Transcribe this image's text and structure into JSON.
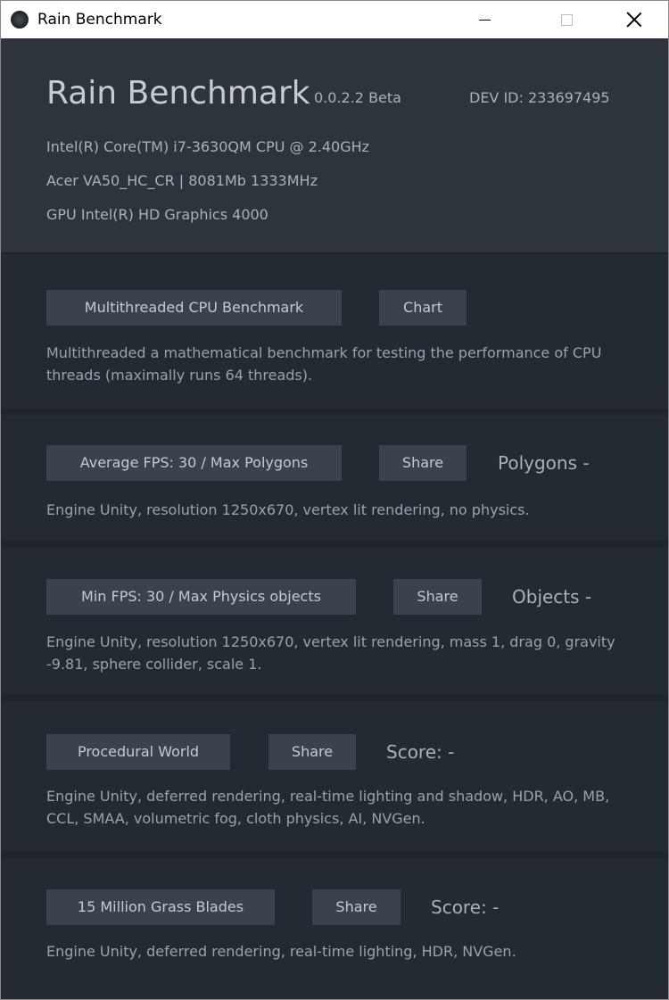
{
  "window": {
    "title": "Rain Benchmark"
  },
  "header": {
    "app_name": "Rain Benchmark",
    "version": "0.0.2.2 Beta",
    "dev_id": "DEV ID: 233697495",
    "cpu": "Intel(R) Core(TM) i7-3630QM CPU @ 2.40GHz",
    "board": "Acer VA50_HC_CR  |  8081Mb 1333MHz",
    "gpu": "GPU Intel(R) HD Graphics 4000"
  },
  "sections": [
    {
      "button_label": "Multithreaded CPU Benchmark",
      "secondary_label": "Chart",
      "result": "",
      "description": "Multithreaded a mathematical benchmark for testing the performance of CPU threads (maximally runs 64 threads)."
    },
    {
      "button_label": "Average FPS: 30 / Max Polygons",
      "secondary_label": "Share",
      "result": "Polygons -",
      "description": "Engine Unity, resolution 1250x670, vertex lit rendering, no physics."
    },
    {
      "button_label": "Min FPS: 30 / Max Physics objects",
      "secondary_label": "Share",
      "result": "Objects -",
      "description": "Engine Unity, resolution 1250x670, vertex lit rendering, mass 1, drag 0, gravity -9.81, sphere collider, scale 1."
    },
    {
      "button_label": "Procedural World",
      "secondary_label": "Share",
      "result": "Score: -",
      "description": "Engine Unity, deferred rendering, real-time lighting and shadow, HDR, AO, MB, CCL, SMAA, volumetric fog, cloth physics, AI, NVGen."
    },
    {
      "button_label": "15 Million Grass Blades",
      "secondary_label": "Share",
      "result": "Score: -",
      "description": "Engine Unity, deferred rendering, real-time lighting, HDR, NVGen."
    }
  ],
  "colors": {
    "window_bg": "#1f2429",
    "header_bg": "#2d343c",
    "section_bg": "#232a31",
    "button_bg": "#3a424c",
    "text_primary": "#c6ccd3",
    "text_secondary": "#aab1b8"
  },
  "icons": {
    "app": "rain-app-icon",
    "minimize": "minimize-icon",
    "maximize": "maximize-icon",
    "close": "close-icon"
  }
}
